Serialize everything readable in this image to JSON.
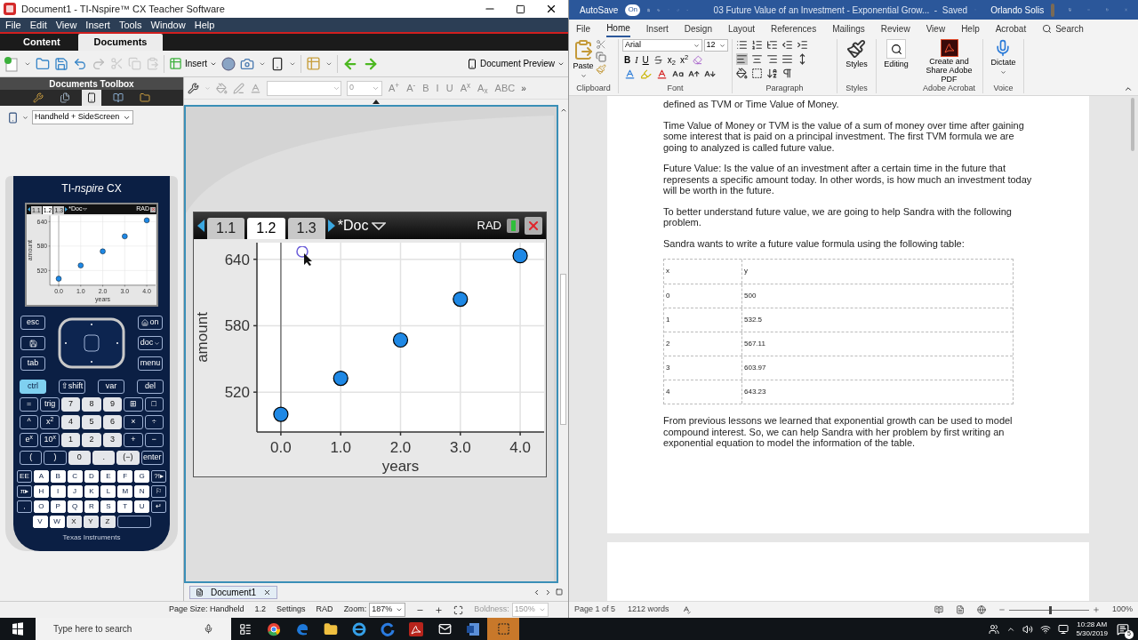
{
  "nspire": {
    "title": "Document1 - TI-Nspire™ CX Teacher Software",
    "menu": [
      "File",
      "Edit",
      "View",
      "Insert",
      "Tools",
      "Window",
      "Help"
    ],
    "tabs": [
      {
        "label": "Content",
        "selected": false
      },
      {
        "label": "Documents",
        "selected": true
      }
    ],
    "toolbar": {
      "insert": "Insert",
      "preview": "Document Preview"
    },
    "toolbox": {
      "title": "Documents Toolbox",
      "icons": [
        {
          "kind": "tools",
          "selected": false
        },
        {
          "kind": "pages",
          "selected": false
        },
        {
          "kind": "handheld",
          "selected": true
        },
        {
          "kind": "book",
          "selected": false
        },
        {
          "kind": "folder",
          "selected": false
        }
      ],
      "view": "Handheld + SideScreen"
    },
    "calculator": {
      "brand": "TI-*nspire* CX",
      "screen": {
        "tabs": [
          {
            "label": "1.1",
            "selected": false
          },
          {
            "label": "1.2",
            "selected": true
          },
          {
            "label": "1.3",
            "selected": false
          }
        ],
        "doc": "*Doc",
        "mode": "RAD",
        "chart_data": {
          "type": "scatter",
          "xlabel": "years",
          "ylabel": "amount",
          "x": [
            0,
            1,
            2,
            3,
            4
          ],
          "series": [
            {
              "color": "#1e88e5",
              "values": [
                500,
                532.5,
                567.11,
                603.97,
                643.23
              ]
            }
          ],
          "xlim": [
            -0.4,
            4.4
          ],
          "ylim": [
            484,
            655
          ],
          "grid": true,
          "xticks": [
            {
              "value": 0,
              "label": "0.0"
            },
            {
              "value": 1,
              "label": "1.0"
            },
            {
              "value": 2,
              "label": "2.0"
            },
            {
              "value": 3,
              "label": "3.0"
            },
            {
              "value": 4,
              "label": "4.0"
            }
          ],
          "yticks": [
            520,
            580,
            640
          ]
        }
      },
      "nav_left": [
        {
          "kind": "text",
          "label": "esc"
        },
        {
          "kind": "save"
        },
        {
          "kind": "text",
          "label": "tab"
        }
      ],
      "nav_right": [
        {
          "kind": "home",
          "label": "on"
        },
        {
          "kind": "caret",
          "label": "doc"
        },
        {
          "kind": "text",
          "label": "menu"
        }
      ],
      "keypad": [
        [
          {
            "label": "ctrl",
            "kind": "lit"
          },
          {
            "label": "⇧shift",
            "kind": "dark"
          },
          {
            "label": "var",
            "kind": "dark"
          },
          {
            "label": "del",
            "kind": "dark"
          }
        ],
        [
          {
            "label": "=",
            "kind": "dark"
          },
          {
            "label": "trig",
            "kind": "dark"
          },
          {
            "label": "7",
            "kind": "light"
          },
          {
            "label": "8",
            "kind": "light"
          },
          {
            "label": "9",
            "kind": "light"
          },
          {
            "label": "⊞",
            "kind": "dark"
          },
          {
            "label": "□",
            "kind": "dark"
          }
        ],
        [
          {
            "label": "^",
            "kind": "dark"
          },
          {
            "label": "x$^{2}$",
            "kind": "dark"
          },
          {
            "label": "4",
            "kind": "light"
          },
          {
            "label": "5",
            "kind": "light"
          },
          {
            "label": "6",
            "kind": "light"
          },
          {
            "label": "×",
            "kind": "dark"
          },
          {
            "label": "÷",
            "kind": "dark"
          }
        ],
        [
          {
            "label": "e$^{x}$",
            "kind": "dark"
          },
          {
            "label": "10$^{x}$",
            "kind": "dark"
          },
          {
            "label": "1",
            "kind": "light"
          },
          {
            "label": "2",
            "kind": "light"
          },
          {
            "label": "3",
            "kind": "light"
          },
          {
            "label": "+",
            "kind": "dark"
          },
          {
            "label": "−",
            "kind": "dark"
          }
        ],
        [
          {
            "label": "(",
            "kind": "dark"
          },
          {
            "label": ")",
            "kind": "dark"
          },
          {
            "label": "0",
            "kind": "light"
          },
          {
            "label": ".",
            "kind": "light"
          },
          {
            "label": "(−)",
            "kind": "light"
          },
          {
            "label": "enter",
            "kind": "dark"
          }
        ]
      ],
      "letters": [
        [
          {
            "label": "EE",
            "kind": "dark"
          },
          {
            "label": "A",
            "kind": "letter"
          },
          {
            "label": "B",
            "kind": "letter"
          },
          {
            "label": "C",
            "kind": "letter"
          },
          {
            "label": "D",
            "kind": "letter"
          },
          {
            "label": "E",
            "kind": "letter"
          },
          {
            "label": "F",
            "kind": "letter"
          },
          {
            "label": "G",
            "kind": "letter"
          },
          {
            "label": "?!▸",
            "kind": "dark"
          }
        ],
        [
          {
            "label": "π▸",
            "kind": "dark"
          },
          {
            "label": "H",
            "kind": "letter"
          },
          {
            "label": "I",
            "kind": "letter"
          },
          {
            "label": "J",
            "kind": "letter"
          },
          {
            "label": "K",
            "kind": "letter"
          },
          {
            "label": "L",
            "kind": "letter"
          },
          {
            "label": "M",
            "kind": "letter"
          },
          {
            "label": "N",
            "kind": "letter"
          },
          {
            "label": "⚐",
            "kind": "dark"
          }
        ],
        [
          {
            "label": ",",
            "kind": "dark"
          },
          {
            "label": "O",
            "kind": "letter"
          },
          {
            "label": "P",
            "kind": "letter"
          },
          {
            "label": "Q",
            "kind": "letter"
          },
          {
            "label": "R",
            "kind": "letter"
          },
          {
            "label": "S",
            "kind": "letter"
          },
          {
            "label": "T",
            "kind": "letter"
          },
          {
            "label": "U",
            "kind": "letter"
          },
          {
            "label": "↵",
            "kind": "dark"
          }
        ],
        [
          {
            "label": "V",
            "kind": "letter"
          },
          {
            "label": "W",
            "kind": "letter"
          },
          {
            "label": "X",
            "kind": "light"
          },
          {
            "label": "Y",
            "kind": "light"
          },
          {
            "label": "Z",
            "kind": "light"
          },
          {
            "kind": "space"
          }
        ]
      ],
      "maker": "Texas Instruments"
    },
    "format_bar": {
      "size": "0",
      "buttons": [
        {
          "label": "A$^{+}$",
          "disabled": true
        },
        {
          "label": "A$^{-}$",
          "disabled": true
        },
        {
          "label": "B",
          "disabled": true
        },
        {
          "label": "I",
          "disabled": true
        },
        {
          "label": "U",
          "disabled": true
        },
        {
          "label": "A$^{x}$",
          "disabled": true
        },
        {
          "label": "A$_{x}$",
          "disabled": true
        },
        {
          "label": "ABC",
          "disabled": true
        }
      ],
      "overflow": "»"
    },
    "handheld": {
      "tabs": [
        {
          "label": "1.1",
          "selected": false
        },
        {
          "label": "1.2",
          "selected": true
        },
        {
          "label": "1.3",
          "selected": false
        }
      ],
      "doc": "*Doc",
      "mode": "RAD",
      "chart_data": {
        "type": "scatter",
        "xlabel": "years",
        "ylabel": "amount",
        "x": [
          0,
          1,
          2,
          3,
          4
        ],
        "series": [
          {
            "color": "#1e88e5",
            "values": [
              500,
              532.5,
              567.11,
              603.97,
              643.23
            ]
          }
        ],
        "xlim": [
          -0.4,
          4.4
        ],
        "ylim": [
          484,
          655
        ],
        "grid": true,
        "xticks": [
          {
            "value": 0,
            "label": "0.0"
          },
          {
            "value": 1,
            "label": "1.0"
          },
          {
            "value": 2,
            "label": "2.0"
          },
          {
            "value": 3,
            "label": "3.0"
          },
          {
            "value": 4,
            "label": "4.0"
          }
        ],
        "yticks": [
          520,
          580,
          640
        ]
      }
    },
    "doc_tab": "Document1",
    "status": {
      "page_size": "Page Size: Handheld",
      "page": "1.2",
      "settings": "Settings",
      "mode": "RAD",
      "zoom_label": "Zoom:",
      "zoom": "187%",
      "boldness_label": "Boldness:",
      "boldness": "150%"
    }
  },
  "word": {
    "autosave": "AutoSave",
    "autosave_on": true,
    "autosave_state": "On",
    "title": "03 Future Value of an Investment - Exponential Grow...  -  Saved",
    "user": "Orlando Solis",
    "tabs": [
      {
        "label": "File",
        "selected": false
      },
      {
        "label": "Home",
        "selected": true
      },
      {
        "label": "Insert",
        "selected": false
      },
      {
        "label": "Design",
        "selected": false
      },
      {
        "label": "Layout",
        "selected": false
      },
      {
        "label": "References",
        "selected": false
      },
      {
        "label": "Mailings",
        "selected": false
      },
      {
        "label": "Review",
        "selected": false
      },
      {
        "label": "View",
        "selected": false
      },
      {
        "label": "Help",
        "selected": false
      },
      {
        "label": "Acrobat",
        "selected": false
      }
    ],
    "search": "Search",
    "ribbon": {
      "paste": "Paste",
      "font": "Arial",
      "size": "12",
      "font_buttons": [
        "B",
        "I",
        "U",
        "x$_{2}$",
        "x$^{2}$"
      ],
      "styles": "Styles",
      "editing": "Editing",
      "pdf": "Create and Share Adobe PDF",
      "dictate": "Dictate",
      "groups": [
        "Clipboard",
        "Font",
        "Paragraph",
        "Styles",
        "Adobe Acrobat",
        "Voice"
      ]
    },
    "paragraphs": [
      "defined as TVM or Time Value of Money.",
      "Time Value of Money or TVM is the value of a sum of money over time after gaining some interest that is paid on a principal investment. The first TVM formula we are going to analyzed is called future value.",
      "Future Value: Is the value of an investment after a certain time in the future that represents a specific amount today. In other words, is how much an investment today will be worth in the future.",
      "To better understand future value, we are going to help Sandra with the following problem.",
      "Sandra wants to write a future value formula using the following table:"
    ],
    "table": {
      "columns": [
        "x",
        "y"
      ],
      "rows": [
        [
          "0",
          "500"
        ],
        [
          "1",
          "532.5"
        ],
        [
          "2",
          "567.11"
        ],
        [
          "3",
          "603.97"
        ],
        [
          "4",
          "643.23"
        ]
      ]
    },
    "after": "From previous lessons we learned that exponential growth can be used to model compound interest. So, we can help Sandra with her problem by first writing an exponential equation to model the information of the table.",
    "status": {
      "page": "Page 1 of 5",
      "words": "1212 words",
      "zoom": "100%"
    },
    "zoom_slider": {
      "level": 0.5
    }
  },
  "taskbar": {
    "search": "Type here to search",
    "time": "10:28 AM",
    "date": "5/30/2019",
    "notifications": "5"
  }
}
